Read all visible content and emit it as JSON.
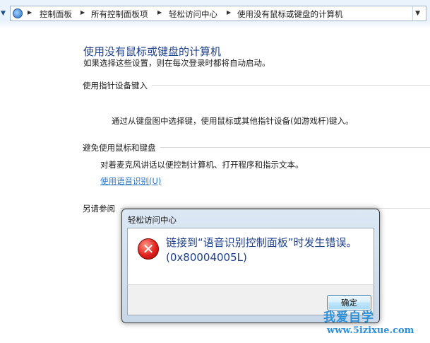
{
  "address_bar": {
    "crumbs": [
      "控制面板",
      "所有控制面板项",
      "轻松访问中心",
      "使用没有鼠标或键盘的计算机"
    ]
  },
  "page": {
    "title": "使用没有鼠标或键盘的计算机",
    "subtitle": "如果选择这些设置，则在每次登录时都将自动启动。",
    "section1": {
      "heading": "使用指针设备键入",
      "text": "通过从键盘图中选择键，使用鼠标或其他指针设备(如游戏杆)键入。"
    },
    "section2": {
      "heading": "避免使用鼠标和键盘",
      "text": "对着麦克风讲话以便控制计算机、打开程序和指示文本。",
      "link": "使用语音识别(U)"
    },
    "section3": {
      "heading": "另请参阅"
    }
  },
  "dialog": {
    "title": "轻松访问中心",
    "message": "链接到“语音识别控制面板”时发生错误。(0x80004005L)",
    "ok_label": "确定"
  },
  "watermark": {
    "text": "我爱自学",
    "url": "www.5izixue.com"
  },
  "colors": {
    "accent": "#1e3f8a",
    "link": "#2a76c6",
    "watermark": "#2f8fd6"
  }
}
